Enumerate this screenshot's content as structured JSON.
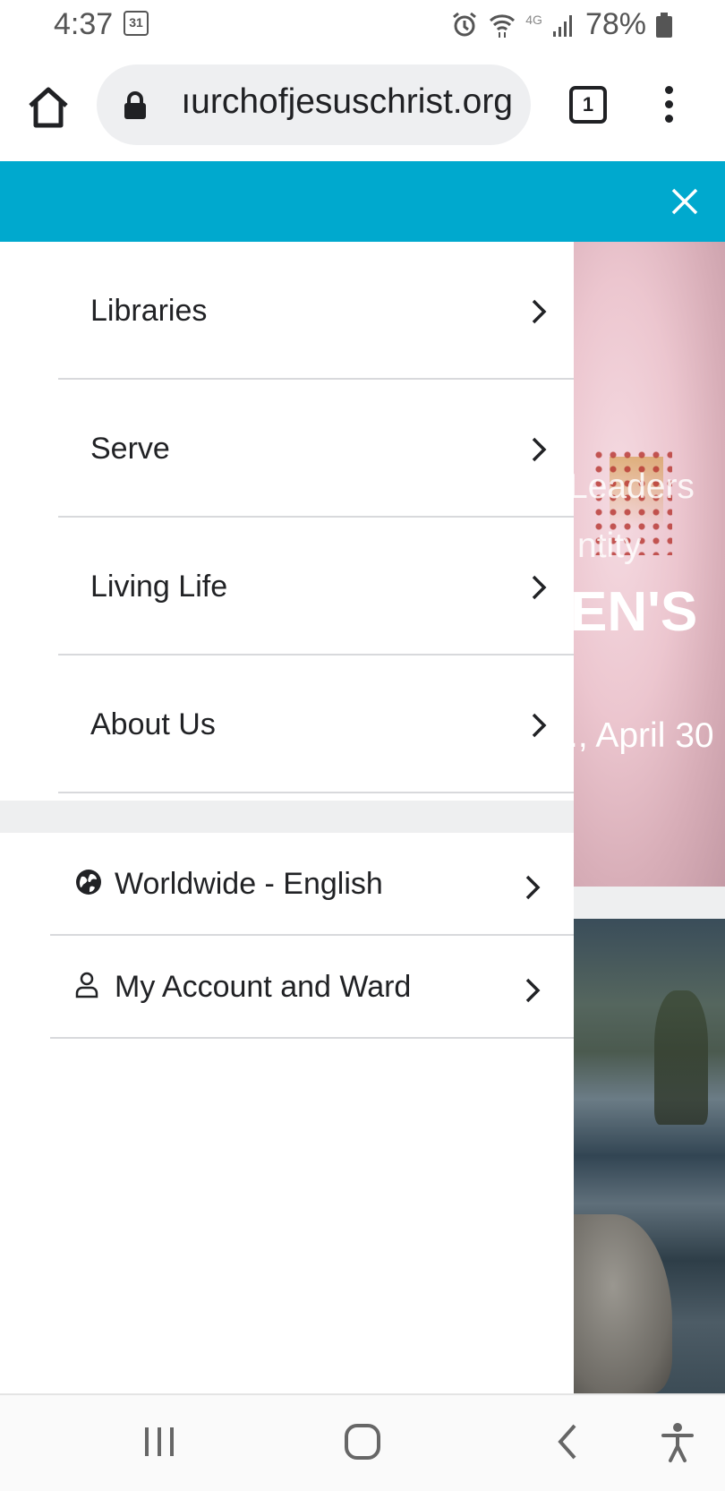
{
  "status_bar": {
    "time": "4:37",
    "calendar_day": "31",
    "network": "4G",
    "battery": "78%"
  },
  "browser": {
    "url": "ıurchofjesuschrist.org",
    "tab_count": "1",
    "icons": [
      "home-icon",
      "lock-icon",
      "tab-switcher-icon",
      "overflow-menu-icon"
    ]
  },
  "banner": {
    "color": "#00a9ce",
    "close_icon": "close-icon"
  },
  "nav_drawer": {
    "items": [
      {
        "label": "Libraries"
      },
      {
        "label": "Serve"
      },
      {
        "label": "Living Life"
      },
      {
        "label": "About Us"
      }
    ],
    "utility_items": [
      {
        "label": "Worldwide - English",
        "icon": "globe-icon"
      },
      {
        "label": "My Account and Ward",
        "icon": "person-icon"
      }
    ]
  },
  "background_page": {
    "hero_lines": [
      "Leaders",
      "ntity",
      "EN'S",
      "., April 30"
    ]
  },
  "system_nav": {
    "icons": [
      "recent-apps-icon",
      "home-circle-icon",
      "back-icon",
      "accessibility-icon"
    ]
  }
}
